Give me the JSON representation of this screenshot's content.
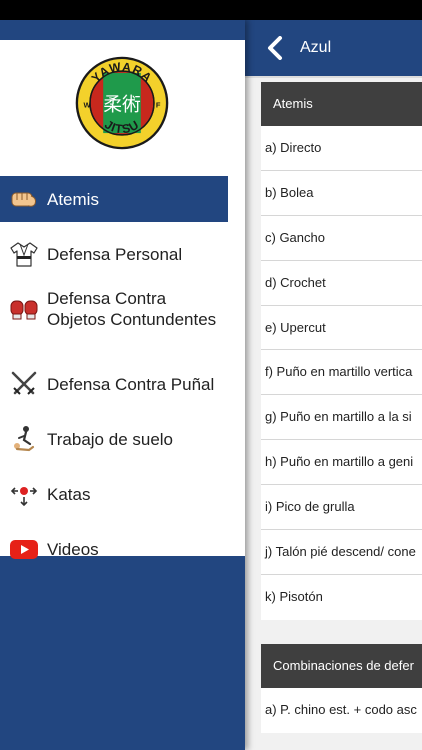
{
  "main": {
    "title": "Azul",
    "sections": [
      {
        "header": "Atemis",
        "items": [
          "a) Directo",
          "b) Bolea",
          "c) Gancho",
          "d) Crochet",
          "e) Upercut",
          "f) Puño en martillo vertica",
          "g) Puño en martillo a la si",
          "h) Puño en martillo a geni",
          "i) Pico de grulla",
          "j) Talón pié descend/ cone",
          "k) Pisotón"
        ]
      },
      {
        "header": "Combinaciones de defer",
        "items": [
          "a) P. chino est. + codo asc"
        ]
      }
    ]
  },
  "drawer": {
    "logo": {
      "text_top": "YAWARA",
      "text_bottom": "JITSU",
      "letter_left": "W",
      "letter_right": "F",
      "kanji": "柔術"
    },
    "menu": [
      {
        "label": "Atemis",
        "icon": "fist-icon",
        "active": true
      },
      {
        "label": "Defensa Personal",
        "icon": "gi-uniform-icon",
        "active": false
      },
      {
        "label": "Defensa Contra Objetos Contundentes",
        "icon": "boxing-gloves-icon",
        "active": false
      },
      {
        "label": "Defensa Contra Puñal",
        "icon": "crossed-swords-icon",
        "active": false
      },
      {
        "label": "Trabajo de suelo",
        "icon": "ground-fighting-icon",
        "active": false
      },
      {
        "label": "Katas",
        "icon": "kata-arrows-icon",
        "active": false
      },
      {
        "label": "Videos",
        "icon": "youtube-icon",
        "active": false
      }
    ]
  },
  "colors": {
    "primary": "#224680",
    "section_header": "#3f3f3f",
    "logo_yellow": "#f3d12b",
    "logo_green": "#1f9a4b",
    "logo_red": "#c7281d"
  }
}
